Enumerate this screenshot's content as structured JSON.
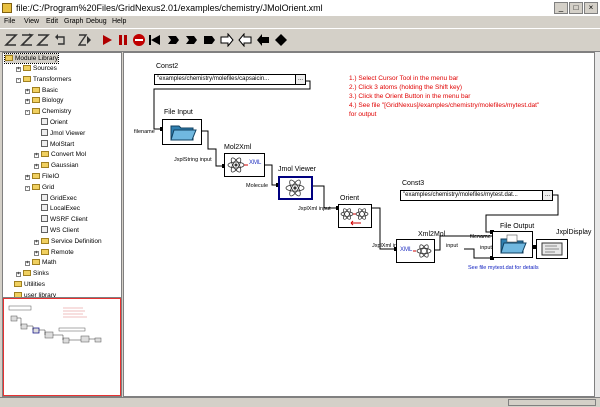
{
  "window": {
    "title": "file:/C:/Program%20Files/GridNexus2.01/examples/chemistry/JMolOrient.xml",
    "minimize": "_",
    "maximize": "□",
    "close": "×"
  },
  "menu": [
    "File",
    "View",
    "Edit",
    "Graph",
    "Debug",
    "Help"
  ],
  "toolbar": {
    "icons": [
      "z-icon",
      "z-reverse-icon",
      "z-step-icon",
      "undo-icon",
      "z-run-icon",
      "run-icon",
      "pause-icon",
      "stop-icon",
      "step-back-icon",
      "flag-icon",
      "flag-icon",
      "flag-right-icon",
      "arrow-right-icon",
      "arrow-left-outline-icon",
      "arrow-left-outline-icon",
      "arrow-left-icon",
      "diamond-icon"
    ]
  },
  "library": {
    "root": "Module Library",
    "items": [
      {
        "label": "Sources",
        "depth": 1,
        "type": "folder",
        "toggle": "+"
      },
      {
        "label": "Transformers",
        "depth": 1,
        "type": "folder",
        "toggle": "-"
      },
      {
        "label": "Basic",
        "depth": 2,
        "type": "folder",
        "toggle": "+"
      },
      {
        "label": "Biology",
        "depth": 2,
        "type": "folder",
        "toggle": "+"
      },
      {
        "label": "Chemistry",
        "depth": 2,
        "type": "folder",
        "toggle": "-"
      },
      {
        "label": "Orient",
        "depth": 3,
        "type": "module"
      },
      {
        "label": "Jmol Viewer",
        "depth": 3,
        "type": "module"
      },
      {
        "label": "MolStart",
        "depth": 3,
        "type": "module"
      },
      {
        "label": "Convert Mol",
        "depth": 3,
        "type": "folder",
        "toggle": "+"
      },
      {
        "label": "Gaussian",
        "depth": 3,
        "type": "folder",
        "toggle": "+"
      },
      {
        "label": "FileIO",
        "depth": 2,
        "type": "folder",
        "toggle": "+"
      },
      {
        "label": "Grid",
        "depth": 2,
        "type": "folder",
        "toggle": "-"
      },
      {
        "label": "GridExec",
        "depth": 3,
        "type": "module"
      },
      {
        "label": "LocalExec",
        "depth": 3,
        "type": "module"
      },
      {
        "label": "WSRF Client",
        "depth": 3,
        "type": "module"
      },
      {
        "label": "WS Client",
        "depth": 3,
        "type": "module"
      },
      {
        "label": "Service Definition",
        "depth": 3,
        "type": "folder",
        "toggle": "+"
      },
      {
        "label": "Remote",
        "depth": 3,
        "type": "folder",
        "toggle": "+"
      },
      {
        "label": "Math",
        "depth": 2,
        "type": "folder",
        "toggle": "+"
      },
      {
        "label": "Sinks",
        "depth": 1,
        "type": "folder",
        "toggle": "+"
      },
      {
        "label": "Utilities",
        "depth": 0,
        "type": "folder"
      },
      {
        "label": "user library",
        "depth": 0,
        "type": "folder"
      }
    ]
  },
  "canvas": {
    "const2": {
      "title": "Const2",
      "value": "\"examples/chemistry/molefiles/capsaicin...",
      "dots": "..."
    },
    "const3": {
      "title": "Const3",
      "value": "\"examples/chemistry/molefiles/mytest.dat...",
      "dots": "..."
    },
    "fileinput": {
      "title": "File Input",
      "port_in": "filename",
      "port_out": "JxplString input"
    },
    "mol2xml": {
      "title": "Mol2Xml",
      "port_in": "JxplString input",
      "port_out": "Molecule",
      "text": "XML"
    },
    "jmolviewer": {
      "title": "Jmol Viewer",
      "port_in": "Molecule",
      "port_out": "JxplXml input"
    },
    "orient": {
      "title": "Orient",
      "port_in": "JxplXml input",
      "port_out": "JxplXml input"
    },
    "xml2mol": {
      "title": "Xml2Mol",
      "port_in": "JxplXml input",
      "port_out": "input",
      "text": "XML"
    },
    "fileoutput": {
      "title": "File Output",
      "port_filename": "filename",
      "port_input": "input"
    },
    "jxpldisplay": {
      "title": "JxplDisplay"
    },
    "notes": [
      "1.) Select Cursor Tool in the menu bar",
      "2.) Click 3 atoms (holding the Shift key)",
      "3.) Click the Orient Button in the menu bar",
      "4.) See file \"[GridNexus]/examples/chemistry/molefiles/mytest.dat\"",
      "     for output"
    ],
    "bluenote": "See file mytest.dat for details"
  },
  "colors": {
    "note": "#e00000",
    "bluenote": "#1020c0",
    "selected_border": "#000080"
  }
}
